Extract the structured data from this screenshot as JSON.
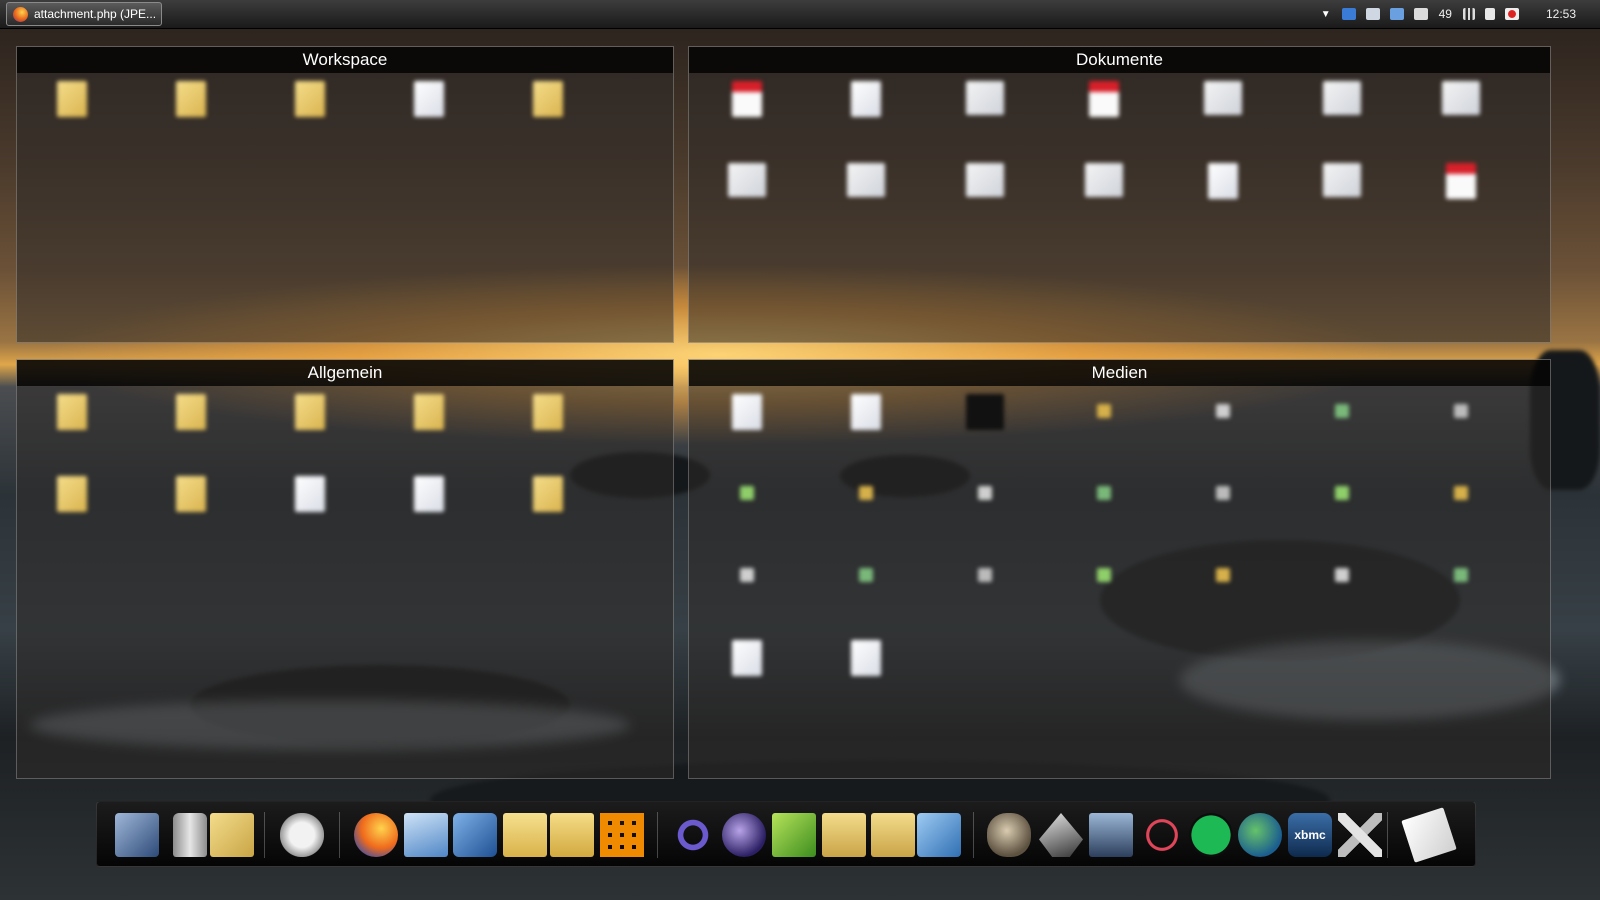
{
  "taskbar": {
    "task_title": "attachment.php (JPE...",
    "tray_number": "49",
    "clock": "12:53"
  },
  "panels": {
    "workspace": {
      "title": "Workspace",
      "items": [
        {
          "type": "folder",
          "icon": "folder-icon"
        },
        {
          "type": "folder",
          "icon": "folder-icon"
        },
        {
          "type": "folder",
          "icon": "folder-icon"
        },
        {
          "type": "doc",
          "icon": "document-icon"
        },
        {
          "type": "folder",
          "icon": "folder-icon"
        }
      ]
    },
    "dokumente": {
      "title": "Dokumente",
      "items": [
        {
          "type": "pdf",
          "icon": "pdf-icon"
        },
        {
          "type": "doc",
          "icon": "document-icon"
        },
        {
          "type": "img",
          "icon": "image-icon"
        },
        {
          "type": "pdf",
          "icon": "pdf-icon"
        },
        {
          "type": "img",
          "icon": "image-icon"
        },
        {
          "type": "img",
          "icon": "image-icon"
        },
        {
          "type": "img",
          "icon": "image-icon"
        },
        {
          "type": "img",
          "icon": "image-icon"
        },
        {
          "type": "img",
          "icon": "image-icon"
        },
        {
          "type": "img",
          "icon": "image-icon"
        },
        {
          "type": "img",
          "icon": "image-icon"
        },
        {
          "type": "doc",
          "icon": "document-icon"
        },
        {
          "type": "img",
          "icon": "image-icon"
        },
        {
          "type": "pdf",
          "icon": "pdf-icon"
        }
      ]
    },
    "allgemein": {
      "title": "Allgemein",
      "items": [
        {
          "type": "folder",
          "icon": "folder-icon"
        },
        {
          "type": "folder",
          "icon": "folder-icon"
        },
        {
          "type": "folder",
          "icon": "folder-icon"
        },
        {
          "type": "folder",
          "icon": "folder-icon"
        },
        {
          "type": "folder",
          "icon": "folder-icon"
        },
        {
          "type": "folder",
          "icon": "folder-icon"
        },
        {
          "type": "folder",
          "icon": "folder-icon"
        },
        {
          "type": "doc",
          "icon": "document-icon"
        },
        {
          "type": "doc",
          "icon": "document-icon"
        },
        {
          "type": "folder",
          "icon": "folder-icon"
        }
      ]
    },
    "medien": {
      "title": "Medien",
      "items": [
        {
          "type": "doc",
          "icon": "media-file-icon"
        },
        {
          "type": "doc",
          "icon": "media-file-icon"
        },
        {
          "type": "dark",
          "icon": "binoculars-icon"
        },
        {
          "type": "dot",
          "icon": "media-file-icon"
        },
        {
          "type": "dot",
          "icon": "media-file-icon"
        },
        {
          "type": "dot",
          "icon": "media-file-icon"
        },
        {
          "type": "dot",
          "icon": "media-file-icon"
        },
        {
          "type": "dot",
          "icon": "media-file-icon"
        },
        {
          "type": "dot",
          "icon": "media-file-icon"
        },
        {
          "type": "dot",
          "icon": "media-file-icon"
        },
        {
          "type": "dot",
          "icon": "media-file-icon"
        },
        {
          "type": "dot",
          "icon": "media-file-icon"
        },
        {
          "type": "dot",
          "icon": "media-file-icon"
        },
        {
          "type": "dot",
          "icon": "media-file-icon"
        },
        {
          "type": "dot",
          "icon": "media-file-icon"
        },
        {
          "type": "dot",
          "icon": "media-file-icon"
        },
        {
          "type": "dot",
          "icon": "media-file-icon"
        },
        {
          "type": "dot",
          "icon": "media-file-icon"
        },
        {
          "type": "dot",
          "icon": "media-file-icon"
        },
        {
          "type": "dot",
          "icon": "media-file-icon"
        },
        {
          "type": "dot",
          "icon": "media-file-icon"
        },
        {
          "type": "doc",
          "icon": "media-file-icon"
        },
        {
          "type": "doc",
          "icon": "media-file-icon"
        }
      ]
    }
  },
  "dock": {
    "items": [
      "computer-icon",
      "trash-icon",
      "user-folder-icon",
      "gamepad-icon",
      "firefox-icon",
      "mail-icon",
      "media-player-icon",
      "file-explorer-icon",
      "downloads-folder-icon",
      "office-icon",
      "visual-studio-icon",
      "eclipse-icon",
      "notepad-icon",
      "dev-folder-icon",
      "project-folder-icon",
      "build-tools-icon",
      "gimp-icon",
      "inkscape-icon",
      "remote-desktop-icon",
      "network-icon",
      "spotify-icon",
      "vlc-globe-icon",
      "xbmc-icon",
      "settings-tools-icon",
      "notes-icon"
    ],
    "xbmc_label": "xbmc"
  },
  "colors": {
    "sunset": "#e0a64a",
    "panel_title_bg": "#000000",
    "folder": "#e6c46a",
    "pdf": "#d8202a",
    "spotify": "#1db954"
  }
}
